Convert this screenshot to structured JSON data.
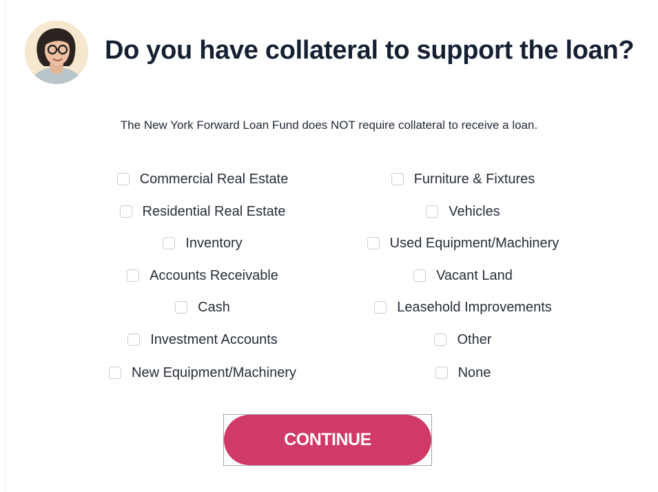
{
  "header": {
    "title": "Do you have collateral to support the loan?",
    "avatar_icon": "advisor-avatar-icon"
  },
  "notice": "The New York Forward Loan Fund does NOT require collateral to receive a loan.",
  "options": {
    "left": [
      {
        "label": "Commercial Real Estate",
        "checked": false
      },
      {
        "label": "Residential Real Estate",
        "checked": false
      },
      {
        "label": "Inventory",
        "checked": false
      },
      {
        "label": "Accounts Receivable",
        "checked": false
      },
      {
        "label": "Cash",
        "checked": false
      },
      {
        "label": "Investment Accounts",
        "checked": false
      },
      {
        "label": "New Equipment/Machinery",
        "checked": false
      }
    ],
    "right": [
      {
        "label": "Furniture & Fixtures",
        "checked": false
      },
      {
        "label": "Vehicles",
        "checked": false
      },
      {
        "label": "Used Equipment/Machinery",
        "checked": false
      },
      {
        "label": "Vacant Land",
        "checked": false
      },
      {
        "label": "Leasehold Improvements",
        "checked": false
      },
      {
        "label": "Other",
        "checked": false
      },
      {
        "label": "None",
        "checked": false
      }
    ]
  },
  "actions": {
    "continue_label": "CONTINUE"
  },
  "colors": {
    "accent": "#cf3a66",
    "title": "#152033",
    "checkbox_border": "#c9ccd1"
  }
}
